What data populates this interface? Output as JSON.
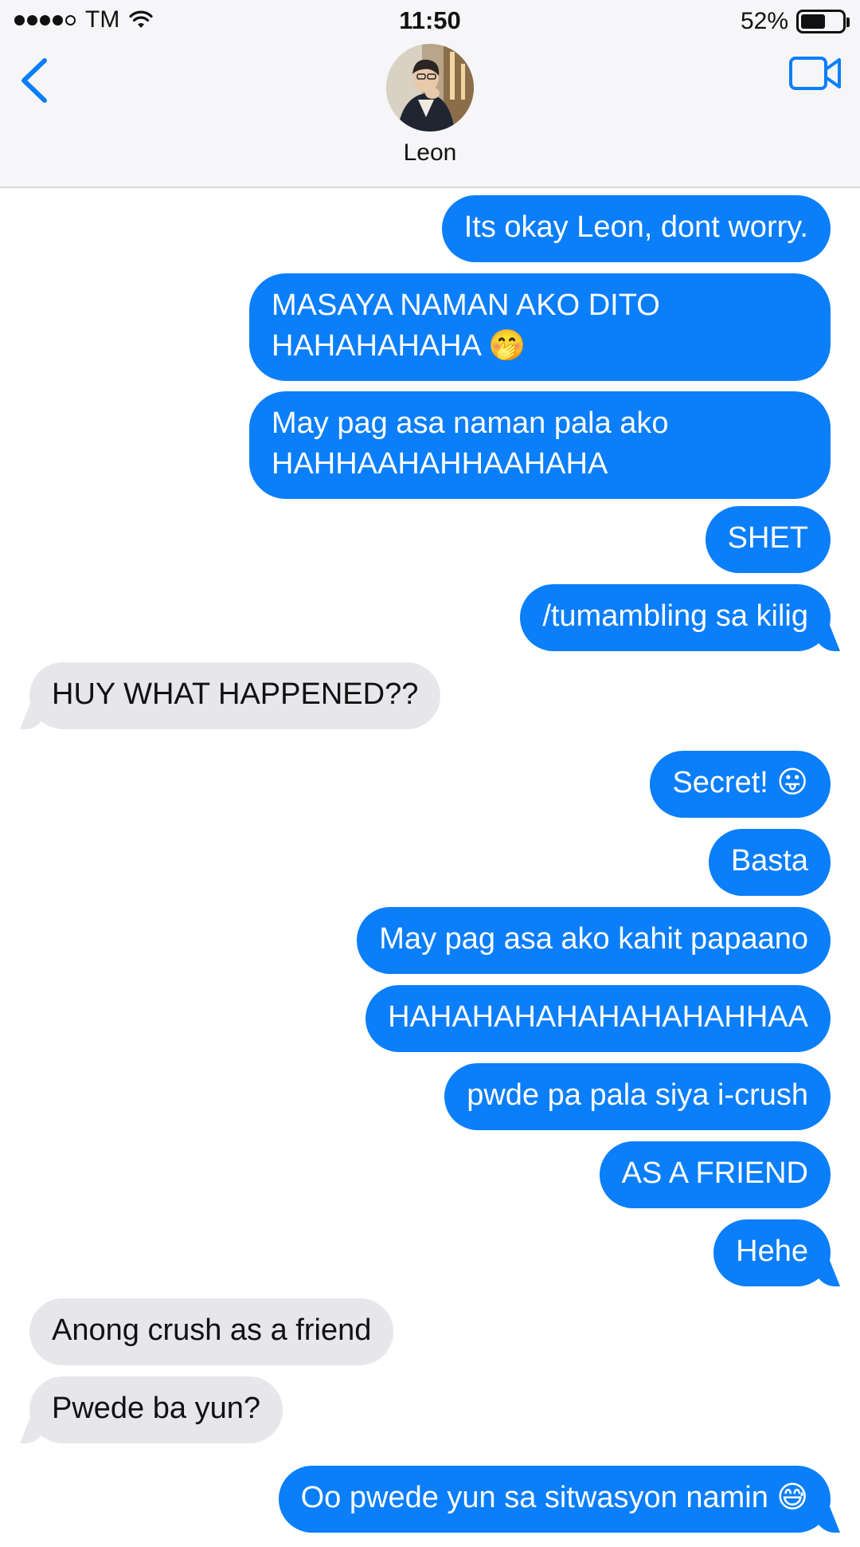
{
  "status_bar": {
    "carrier": "TM",
    "time": "11:50",
    "battery": "52%",
    "signal_bars": 4,
    "signal_total": 5
  },
  "header": {
    "contact_name": "Leon",
    "back_icon": "chevron-left-icon",
    "video_icon": "video-camera-icon",
    "accent_color": "#0b7ef9"
  },
  "messages": [
    {
      "from": "me",
      "text": "Its okay Leon, dont worry."
    },
    {
      "from": "me",
      "text": "MASAYA NAMAN AKO DITO HAHAHAHAHA 🤭"
    },
    {
      "from": "me",
      "text": "May pag asa naman pala ako HAHHAAHAHHAAHAHA"
    },
    {
      "from": "me",
      "text": "SHET"
    },
    {
      "from": "me",
      "text": "/tumambling sa kilig"
    },
    {
      "from": "them",
      "text": "HUY WHAT HAPPENED??"
    },
    {
      "from": "me",
      "text": "Secret! 😛"
    },
    {
      "from": "me",
      "text": "Basta"
    },
    {
      "from": "me",
      "text": "May pag asa ako kahit papaano"
    },
    {
      "from": "me",
      "text": "HAHAHAHAHAHAHAHAHHAA"
    },
    {
      "from": "me",
      "text": "pwde pa pala siya i-crush"
    },
    {
      "from": "me",
      "text": "AS A FRIEND"
    },
    {
      "from": "me",
      "text": "Hehe"
    },
    {
      "from": "them",
      "text": "Anong crush as a friend"
    },
    {
      "from": "them",
      "text": "Pwede ba yun?"
    },
    {
      "from": "me",
      "text": "Oo pwede yun sa sitwasyon namin 😅"
    }
  ]
}
